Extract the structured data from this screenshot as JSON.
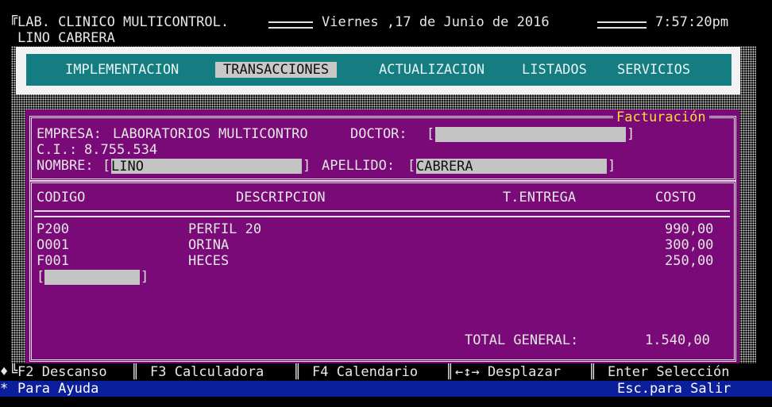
{
  "header": {
    "lab_name": "LAB. CLINICO MULTICONTROL.",
    "date": "Viernes ,17 de Junio de 2016",
    "time": "7:57:20pm",
    "user": "LINO CABRERA"
  },
  "menu": [
    {
      "label": "IMPLEMENTACION"
    },
    {
      "label": "TRANSACCIONES"
    },
    {
      "label": "ACTUALIZACION"
    },
    {
      "label": "LISTADOS"
    },
    {
      "label": "SERVICIOS"
    }
  ],
  "panel": {
    "title": "Facturación",
    "empresa_label": "EMPRESA:",
    "empresa_value": "LABORATORIOS MULTICONTRO",
    "doctor_label": "DOCTOR:",
    "doctor_value": "",
    "ci_label": "C.I.:",
    "ci_value": "8.755.534",
    "nombre_label": "NOMBRE:",
    "nombre_value": "LINO",
    "apellido_label": "APELLIDO:",
    "apellido_value": "CABRERA"
  },
  "table": {
    "columns": [
      "CODIGO",
      "DESCRIPCION",
      "T.ENTREGA",
      "COSTO"
    ],
    "rows": [
      {
        "codigo": "P200",
        "descripcion": "PERFIL 20",
        "entrega": "",
        "costo": "990,00"
      },
      {
        "codigo": "O001",
        "descripcion": "ORINA",
        "entrega": "",
        "costo": "300,00"
      },
      {
        "codigo": "F001",
        "descripcion": "HECES",
        "entrega": "",
        "costo": "250,00"
      }
    ],
    "new_code_value": "",
    "total_label": "TOTAL GENERAL:",
    "total_value": "1.540,00"
  },
  "status": {
    "f2": "F2 Descanso",
    "f3": "F3 Calculadora",
    "f4": "F4 Calendario",
    "move": "←↕→ Desplazar",
    "enter": "Enter Selección",
    "help": "Para Ayuda",
    "esc": "Esc.para Salir"
  },
  "colors": {
    "menu_bar": "#137d82",
    "panel": "#7a0a78",
    "title_accent": "#ffdc3a",
    "help_bar": "#0b1e9c"
  }
}
